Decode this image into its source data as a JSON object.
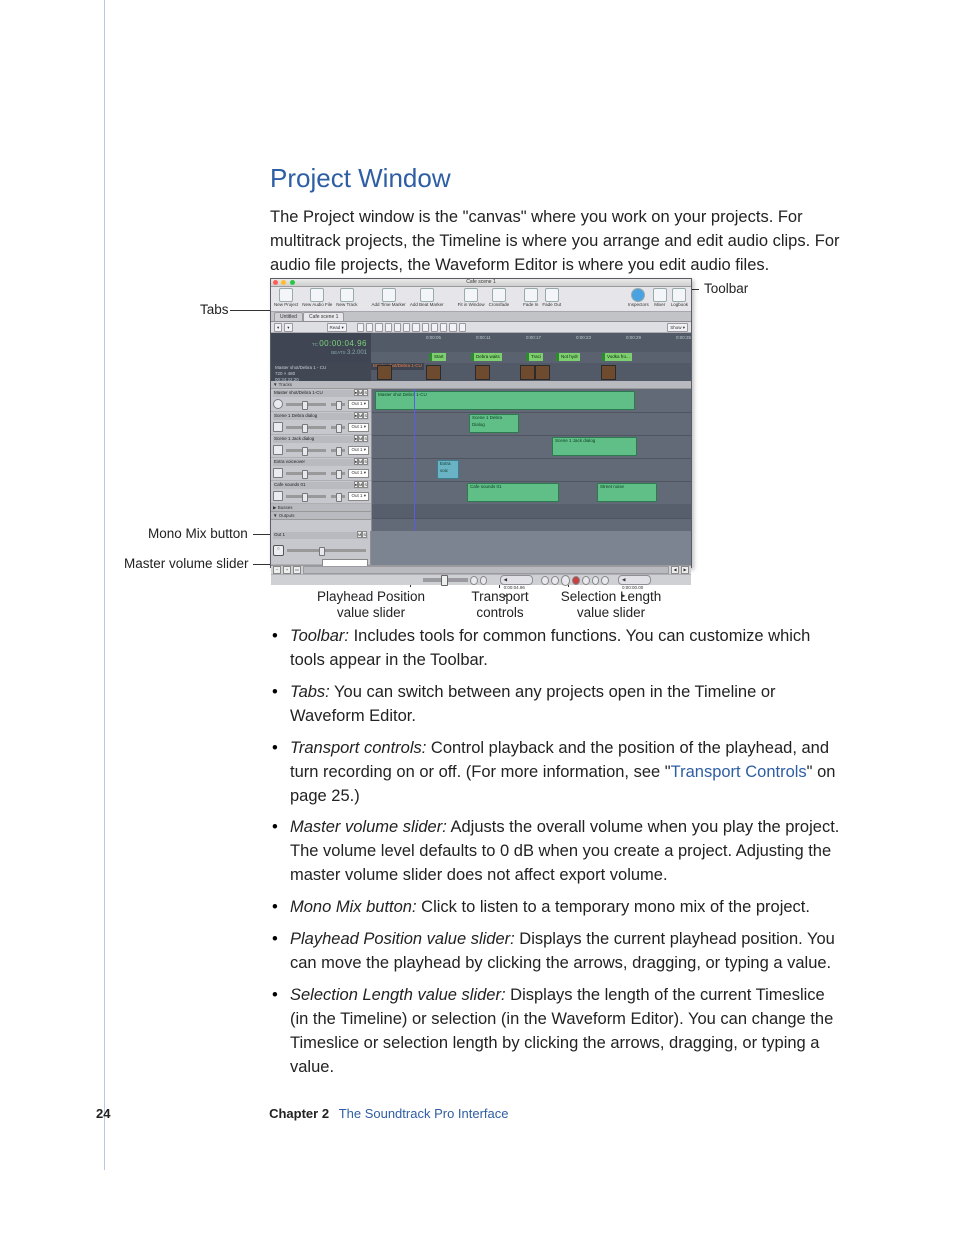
{
  "section": {
    "heading": "Project Window",
    "intro": "The Project window is the \"canvas\" where you work on your projects. For multitrack projects, the Timeline is where you arrange and edit audio clips. For audio file projects, the Waveform Editor is where you edit audio files."
  },
  "callouts": {
    "toolbar": "Toolbar",
    "tabs": "Tabs",
    "mono": "Mono Mix button",
    "master": "Master volume slider",
    "playhead1": "Playhead Position",
    "playhead2": "value slider",
    "transport1": "Transport",
    "transport2": "controls",
    "sel1": "Selection Length",
    "sel2": "value slider"
  },
  "shot": {
    "window_title": "Cafe scene 1",
    "toolbar_items": [
      "New Project",
      "New Audio File",
      "New Track",
      "Add Time Marker",
      "Add Beat Marker",
      "Fit in Window",
      "Crossfade",
      "Fade In",
      "Fade Out",
      "Inspectors",
      "Mixer",
      "Logbook"
    ],
    "tabs": [
      "Untitled",
      "Cafe scene 1"
    ],
    "show_label": "Show ▾",
    "read_btn": "Read ▾",
    "counter_tc_label": "TC",
    "counter_tc": "00:00:04.96",
    "counter_beats_label": "BEATS",
    "counter_beats": "3.2.001",
    "markers": [
      "Start",
      "Debra waits",
      "Traci",
      "Not hydr",
      "Vodka fro..."
    ],
    "video_hdr_title": "Master shot/Debra 1 - CU",
    "video_hdr_meta1": "720 × 480",
    "video_hdr_meta2": "00:34:22:20",
    "video_hdr_meta3": "29.96 fps",
    "vstrip_clip": "Master shot/Debra 1-CU",
    "tracks_header": "▼ Tracks",
    "tracks": [
      {
        "name": "Master shot/Debra 1-CU"
      },
      {
        "name": "Scene 1 Debra dialog"
      },
      {
        "name": "Scene 1 Jack dialog"
      },
      {
        "name": "Extra voiceover"
      },
      {
        "name": "Cafe sounds 01"
      }
    ],
    "out_select": "Out 1 ▾",
    "busses_header": "▶ Busses",
    "outputs_header": "▼ Outputs",
    "output_track": "Out 1",
    "clips": {
      "c1": "Master shot Debra 1-CU",
      "c2": "Scene 1 Debra Dialog",
      "c3": "Scene 1 Jack dialog",
      "c4": "Extra voic",
      "c5": "Cafe sounds 01",
      "c6": "Street noise"
    },
    "playhead_chip": "◀ 0:00:04.96 ▶",
    "sel_chip": "◀ 0:00:00.00 ▶",
    "ruler_ticks": [
      "0:00:05",
      "0:00:11",
      "0:00:17",
      "0:00:23",
      "0:00:29",
      "0:00:35"
    ]
  },
  "bullets": [
    {
      "term": "Toolbar:",
      "text": "  Includes tools for common functions. You can customize which tools appear in the Toolbar."
    },
    {
      "term": "Tabs:",
      "text": "  You can switch between any projects open in the Timeline or Waveform Editor."
    },
    {
      "term": "Transport controls:",
      "text_a": "  Control playback and the position of the playhead, and turn recording on or off. (For more information, see \"",
      "link": "Transport Controls",
      "text_b": "\" on page 25.)"
    },
    {
      "term": "Master volume slider:",
      "text": "  Adjusts the overall volume when you play the project. The volume level defaults to 0 dB when you create a project. Adjusting the master volume slider does not affect export volume."
    },
    {
      "term": "Mono Mix button:",
      "text": "  Click to listen to a temporary mono mix of the project."
    },
    {
      "term": "Playhead Position value slider:",
      "text": "  Displays the current playhead position. You can move the playhead by clicking the arrows, dragging, or typing a value."
    },
    {
      "term": "Selection Length value slider:",
      "text": "  Displays the length of the current Timeslice (in the Timeline) or selection (in the Waveform Editor). You can change the Timeslice or selection length by clicking the arrows, dragging, or typing a value."
    }
  ],
  "footer": {
    "page": "24",
    "chapter": "Chapter 2",
    "title": "The Soundtrack Pro Interface"
  }
}
